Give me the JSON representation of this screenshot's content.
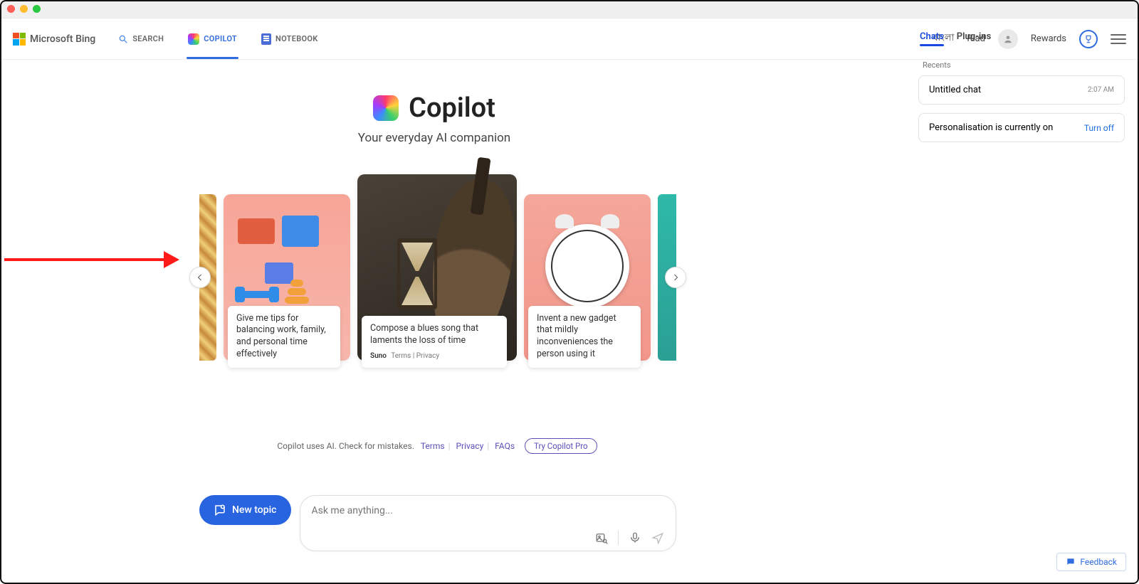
{
  "brand": "Microsoft Bing",
  "nav": {
    "search": "SEARCH",
    "copilot": "COPILOT",
    "notebook": "NOTEBOOK"
  },
  "header": {
    "lang": "বাংলা",
    "user": "Riad",
    "rewards": "Rewards"
  },
  "rightPanel": {
    "tab_chats": "Chats",
    "tab_plugins": "Plug-ins",
    "recents_label": "Recents",
    "chat_title": "Untitled chat",
    "chat_time": "2:07 AM",
    "personalisation": "Personalisation is currently on",
    "turn_off": "Turn off"
  },
  "hero": {
    "title": "Copilot",
    "subtitle": "Your everyday AI companion"
  },
  "cards": {
    "c1": "Give me tips for balancing work, family, and personal time effectively",
    "c2": "Compose a blues song that laments the loss of time",
    "c2_brand": "Suno",
    "c2_terms": "Terms",
    "c2_privacy": "Privacy",
    "c3": "Invent a new gadget that mildly inconveniences the person using it"
  },
  "footer": {
    "disclaimer": "Copilot uses AI. Check for mistakes.",
    "terms": "Terms",
    "privacy": "Privacy",
    "faqs": "FAQs",
    "try_pro": "Try Copilot Pro"
  },
  "bottom": {
    "new_topic": "New topic",
    "placeholder": "Ask me anything..."
  },
  "feedback": "Feedback"
}
